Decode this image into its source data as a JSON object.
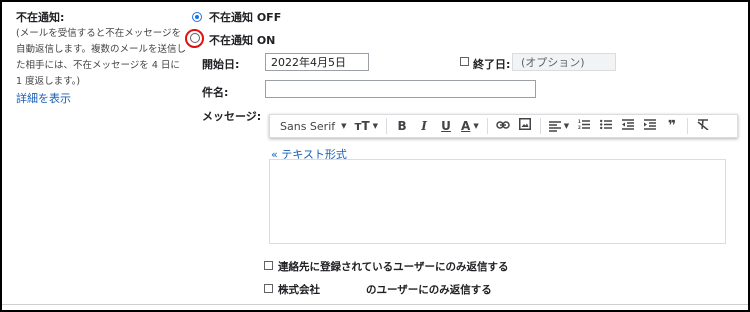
{
  "vacation": {
    "title": "不在通知:",
    "description": "(メールを受信すると不在メッセージを自動返信します。複数のメールを送信した相手には、不在メッセージを 4 日に 1 度返します。)",
    "details_link": "詳細を表示",
    "option_off": "不在通知 OFF",
    "option_on": "不在通知 ON",
    "selected": "off"
  },
  "form": {
    "start_label": "開始日:",
    "start_value": "2022年4月5日",
    "end_label": "終了日:",
    "end_placeholder": "(オプション)",
    "subject_label": "件名:",
    "subject_value": "",
    "message_label": "メッセージ:"
  },
  "toolbar": {
    "font_name": "Sans Serif",
    "icons": [
      "text-size-icon",
      "bold-icon",
      "italic-icon",
      "underline-icon",
      "text-color-icon",
      "link-icon",
      "image-icon",
      "align-icon",
      "numbered-list-icon",
      "bulleted-list-icon",
      "indent-less-icon",
      "indent-more-icon",
      "quote-icon",
      "remove-formatting-icon"
    ]
  },
  "editor": {
    "richtext_link": "« テキスト形式",
    "body": ""
  },
  "options": {
    "contacts_only": "連絡先に登録されているユーザーにのみ返信する",
    "company_prefix": "株式会社",
    "company_suffix": "のユーザーにのみ返信する"
  }
}
